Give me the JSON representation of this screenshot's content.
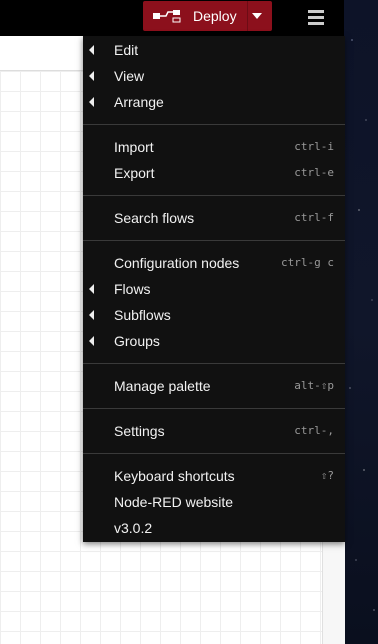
{
  "header": {
    "deploy_label": "Deploy",
    "deploy_color": "#8c101c"
  },
  "menu": {
    "edit": "Edit",
    "view": "View",
    "arrange": "Arrange",
    "import": "Import",
    "import_key": "ctrl-i",
    "export": "Export",
    "export_key": "ctrl-e",
    "search_flows": "Search flows",
    "search_flows_key": "ctrl-f",
    "configuration_nodes": "Configuration nodes",
    "configuration_nodes_key": "ctrl-g c",
    "flows": "Flows",
    "subflows": "Subflows",
    "groups": "Groups",
    "manage_palette": "Manage palette",
    "manage_palette_key": "alt-⇧p",
    "settings": "Settings",
    "settings_key": "ctrl-,",
    "keyboard_shortcuts": "Keyboard shortcuts",
    "keyboard_shortcuts_key": "⇧?",
    "website": "Node-RED website",
    "version": "v3.0.2"
  },
  "icons": {
    "deploy": "flow-icon",
    "deploy_caret": "caret-down-icon",
    "menu": "hamburger-menu-icon",
    "submenu": "caret-left-icon"
  }
}
